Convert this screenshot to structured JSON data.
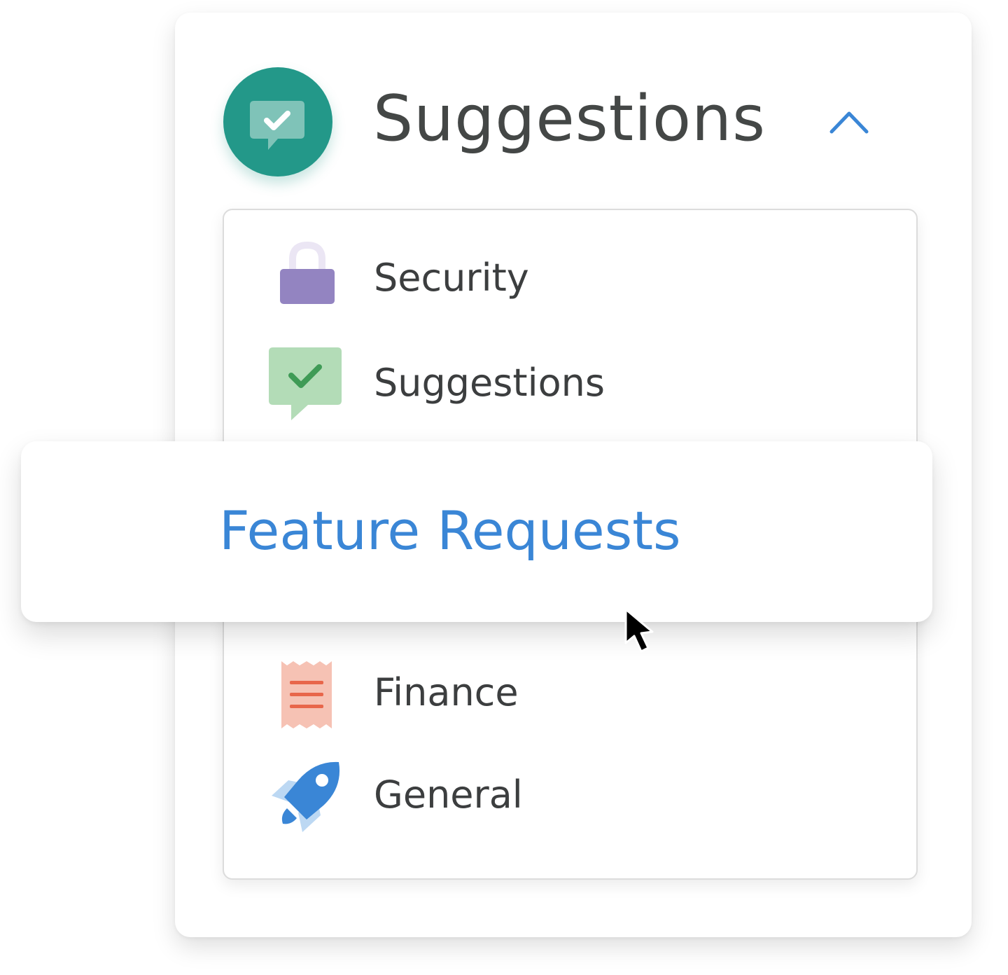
{
  "header": {
    "title": "Suggestions",
    "badge_icon": "chat-check-icon",
    "toggle_icon": "chevron-up-icon",
    "badge_color": "#239889",
    "toggle_color": "#3a86d6"
  },
  "menu": {
    "items": [
      {
        "label": "Security",
        "icon": "lock-icon",
        "icon_color": "#9384c1"
      },
      {
        "label": "Suggestions",
        "icon": "chat-check-icon",
        "icon_color": "#b3dcb7"
      },
      {
        "label": "Finance",
        "icon": "receipt-icon",
        "icon_color": "#f6c2b4"
      },
      {
        "label": "General",
        "icon": "rocket-icon",
        "icon_color": "#3a86d6"
      }
    ],
    "highlighted": {
      "label": "Feature Requests",
      "color": "#3a86d6"
    }
  },
  "cursor": {
    "icon": "mouse-pointer-icon"
  }
}
